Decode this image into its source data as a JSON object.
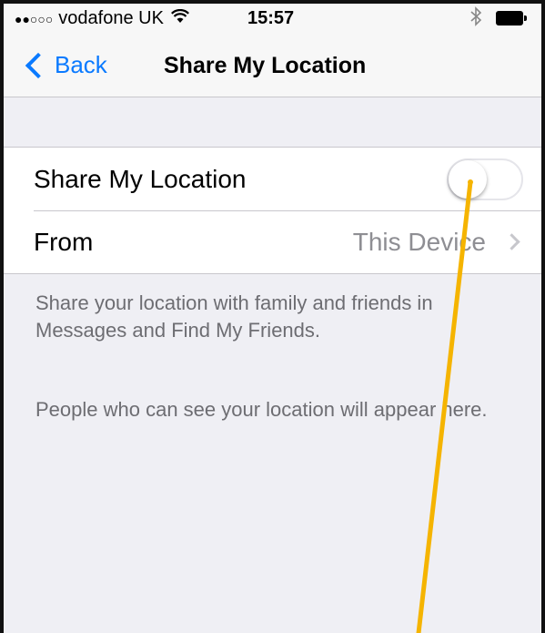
{
  "status_bar": {
    "signal_dots": "●●○○○",
    "carrier": "vodafone UK",
    "time": "15:57"
  },
  "nav": {
    "back_label": "Back",
    "title": "Share My Location"
  },
  "settings": {
    "share_label": "Share My Location",
    "share_enabled": false,
    "from_label": "From",
    "from_value": "This Device"
  },
  "footer": {
    "description": "Share your location with family and friends in Messages and Find My Friends.",
    "people_note": "People who can see your location will appear here."
  },
  "colors": {
    "accent": "#0a7aff",
    "annotation": "#f5b400",
    "background": "#efeff4"
  }
}
